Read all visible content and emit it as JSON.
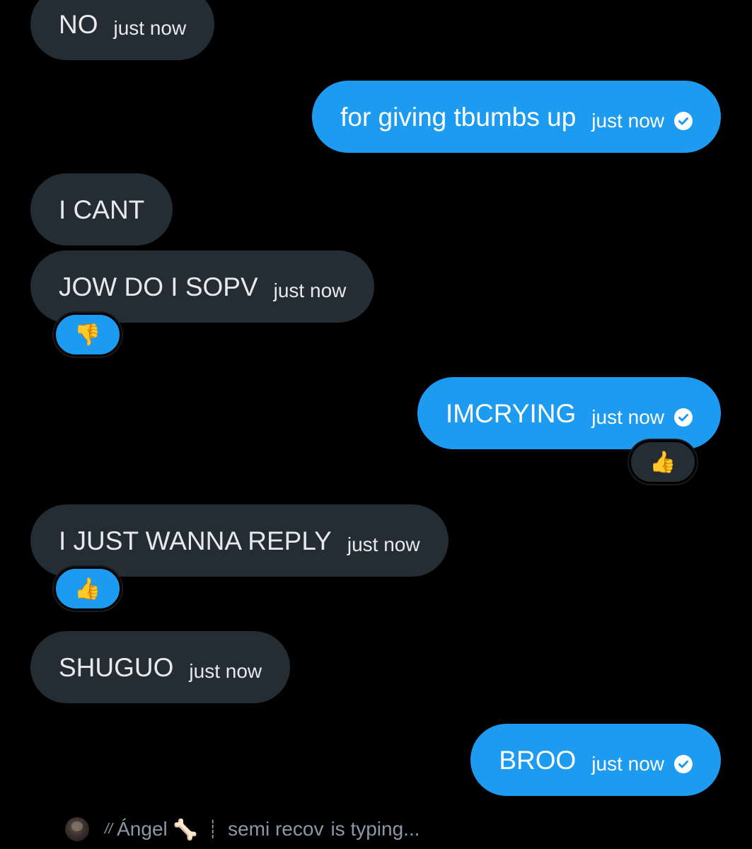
{
  "colors": {
    "background": "#000000",
    "incoming_bubble": "#242d34",
    "outgoing_bubble": "#1d9bf0",
    "text_light": "#e7e9ea",
    "typing_text": "#8b98a5"
  },
  "messages": [
    {
      "direction": "incoming",
      "text": "NO",
      "time": "just now"
    },
    {
      "direction": "outgoing",
      "text": "for giving tbumbs up",
      "time": "just now",
      "status_icon": "check-circle-icon"
    },
    {
      "direction": "incoming",
      "text": "I CANT",
      "time": ""
    },
    {
      "direction": "incoming",
      "text": "JOW DO I SOPV",
      "time": "just now",
      "reaction": "👎"
    },
    {
      "direction": "outgoing",
      "text": "IMCRYING",
      "time": "just now",
      "status_icon": "check-circle-icon",
      "reaction": "👍"
    },
    {
      "direction": "incoming",
      "text": "I JUST WANNA REPLY",
      "time": "just now",
      "reaction": "👍"
    },
    {
      "direction": "incoming",
      "text": "SHUGUO",
      "time": "just now"
    },
    {
      "direction": "outgoing",
      "text": "BROO",
      "time": "just now",
      "status_icon": "check-circle-icon"
    }
  ],
  "typing": {
    "prefix": "//",
    "name": "Ángel",
    "emoji": "🦴",
    "separator": "┊",
    "name_suffix": "semi recov",
    "status": "is typing..."
  }
}
